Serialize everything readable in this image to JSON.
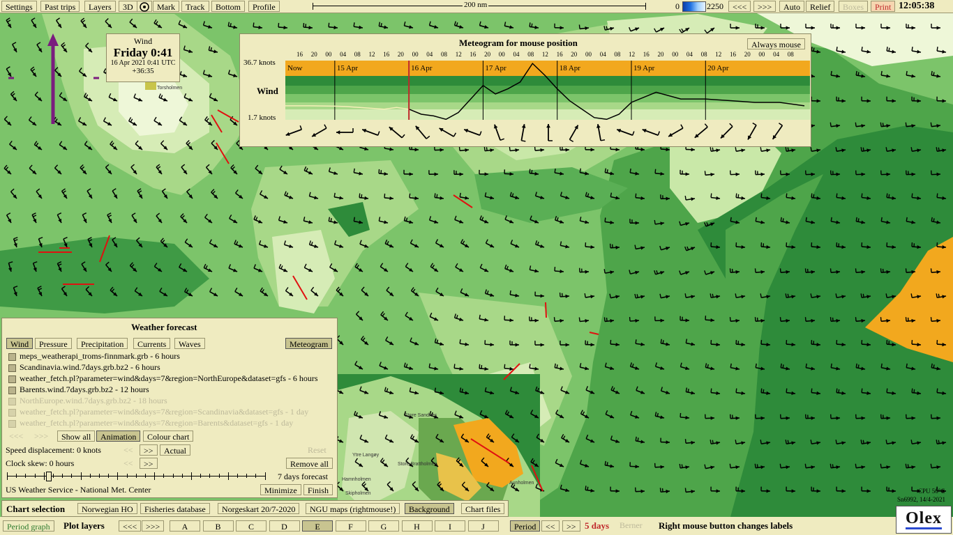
{
  "topbar": {
    "menu": [
      {
        "id": "settings",
        "label": "Settings"
      },
      {
        "id": "past-trips",
        "label": "Past trips"
      },
      {
        "id": "layers",
        "label": "Layers"
      },
      {
        "id": "3d",
        "label": "3D"
      },
      {
        "id": "mark",
        "label": "Mark"
      },
      {
        "id": "track",
        "label": "Track"
      },
      {
        "id": "bottom",
        "label": "Bottom"
      },
      {
        "id": "profile",
        "label": "Profile"
      }
    ],
    "scale_label": "200 nm",
    "depth_min": "0",
    "depth_max": "2250",
    "nav_back": "<<<",
    "nav_fwd": ">>>",
    "auto": "Auto",
    "relief": "Relief",
    "boxes": "Boxes",
    "print": "Print",
    "clock": "12:05:38"
  },
  "wind_info": {
    "title": "Wind",
    "day": "Friday 0:41",
    "utc": "16 Apr 2021 0:41 UTC",
    "offset": "+36:35"
  },
  "meteogram": {
    "title": "Meteogram for mouse position",
    "always_mouse": "Always mouse",
    "hours": [
      "16",
      "20",
      "00",
      "04",
      "08",
      "12",
      "16",
      "20",
      "00",
      "04",
      "08",
      "12",
      "16",
      "20",
      "00",
      "04",
      "08",
      "12",
      "16",
      "20",
      "00",
      "04",
      "08",
      "12",
      "16",
      "20",
      "00",
      "04",
      "08",
      "12",
      "16",
      "20",
      "00",
      "04",
      "08"
    ],
    "max_label": "36.7 knots",
    "min_label": "1.7 knots",
    "series_label": "Wind",
    "days": [
      "Now",
      "15 Apr",
      "16 Apr",
      "17 Apr",
      "18 Apr",
      "19 Apr",
      "20 Apr"
    ]
  },
  "chart_data": {
    "type": "line",
    "title": "Meteogram for mouse position",
    "ylabel": "Wind",
    "ylim": [
      1.7,
      36.7
    ],
    "y_unit": "knots",
    "categories": [
      "Now",
      "15 Apr",
      "16 Apr",
      "17 Apr",
      "18 Apr",
      "19 Apr",
      "20 Apr"
    ],
    "series": [
      {
        "name": "Wind",
        "x_hours": [
          0,
          8,
          16,
          20,
          24,
          28,
          32,
          36,
          40,
          44,
          48,
          52,
          56,
          60,
          64,
          68,
          72,
          76,
          80,
          84,
          88,
          92,
          96,
          100,
          104,
          108,
          112,
          120,
          128,
          136,
          144,
          152,
          160,
          168
        ],
        "values": [
          10,
          10,
          9.8,
          9.5,
          9,
          8.5,
          8,
          9,
          8,
          5,
          4,
          2,
          6,
          14,
          22,
          17,
          20,
          24,
          35,
          28,
          20,
          13,
          8,
          3,
          2,
          5,
          12,
          18,
          14,
          14,
          13,
          12,
          12,
          10
        ]
      }
    ]
  },
  "forecast": {
    "title": "Weather forecast",
    "tabs": [
      {
        "id": "wind",
        "label": "Wind",
        "active": true
      },
      {
        "id": "pressure",
        "label": "Pressure",
        "active": false
      },
      {
        "id": "precipitation",
        "label": "Precipitation",
        "active": false
      },
      {
        "id": "currents",
        "label": "Currents",
        "active": false
      },
      {
        "id": "waves",
        "label": "Waves",
        "active": false
      }
    ],
    "meteogram_btn": "Meteogram",
    "files": [
      {
        "label": "meps_weatherapi_troms-finnmark.grb - 6 hours",
        "active": true
      },
      {
        "label": "Scandinavia.wind.7days.grb.bz2 - 6 hours",
        "active": true
      },
      {
        "label": "weather_fetch.pl?parameter=wind&days=7&region=NorthEurope&dataset=gfs - 6 hours",
        "active": true
      },
      {
        "label": "Barents.wind.7days.grb.bz2 - 12 hours",
        "active": true
      },
      {
        "label": "NorthEurope.wind.7days.grb.bz2 - 18 hours",
        "active": false
      },
      {
        "label": "weather_fetch.pl?parameter=wind&days=7&region=Scandinavia&dataset=gfs - 1 day",
        "active": false
      },
      {
        "label": "weather_fetch.pl?parameter=wind&days=7&region=Barents&dataset=gfs - 1 day",
        "active": false
      }
    ],
    "nav_back": "<<<",
    "nav_fwd": ">>>",
    "show_all": "Show all",
    "animation": "Animation",
    "colour_chart": "Colour chart",
    "speed_label": "Speed displacement: 0 knots",
    "speed_back": "<<",
    "speed_fwd": ">>",
    "actual": "Actual",
    "reset": "Reset",
    "clock_label": "Clock skew: 0 hours",
    "clock_back": "<<",
    "clock_fwd": ">>",
    "remove_all": "Remove all",
    "forecast_range": "7 days forecast",
    "slider_position": 0.16,
    "source": "US Weather Service - National Met. Center",
    "minimize": "Minimize",
    "finish": "Finish"
  },
  "chart_selection": {
    "title": "Chart selection",
    "buttons": [
      {
        "label": "Norwegian HO",
        "active": false
      },
      {
        "label": "Fisheries database",
        "active": false
      },
      {
        "label": "Norgeskart 20/7-2020",
        "active": false
      },
      {
        "label": "NGU maps (rightmouse!)",
        "active": false
      },
      {
        "label": "Background",
        "active": true
      },
      {
        "label": "Chart files",
        "active": false
      }
    ]
  },
  "bottombar": {
    "period_graph": "Period graph",
    "plot_layers": "Plot layers",
    "back": "<<<",
    "fwd": ">>>",
    "layers": [
      "A",
      "B",
      "C",
      "D",
      "E",
      "F",
      "G",
      "H",
      "I",
      "J"
    ],
    "active_layer": "E",
    "period": "Period",
    "p_back": "<<",
    "p_fwd": ">>",
    "days": "5 days",
    "berner": "Berner",
    "hint": "Right mouse button changes labels",
    "logo": "Olex"
  },
  "status": {
    "cpu": "CPU 56°C",
    "serial": "Sn6992, 14/4-2021"
  },
  "map_labels": {
    "place1": "Torsholmen",
    "place2": "Store Sandnes",
    "place3": "Store Brattholmen",
    "place4": "Ytre Langøy",
    "place5": "Hamnholmen",
    "place6": "Skipholmen",
    "place7": "Aunholmen"
  },
  "colors": {
    "panel": "#efebc0",
    "map_dark": "#2e8b3a",
    "map_mid": "#7cc46a",
    "map_light": "#c9e8a8",
    "map_pale": "#eef7d8",
    "orange": "#f2a81e",
    "purple": "#7a1c7e",
    "depth_blue": "#1e6fe0"
  }
}
